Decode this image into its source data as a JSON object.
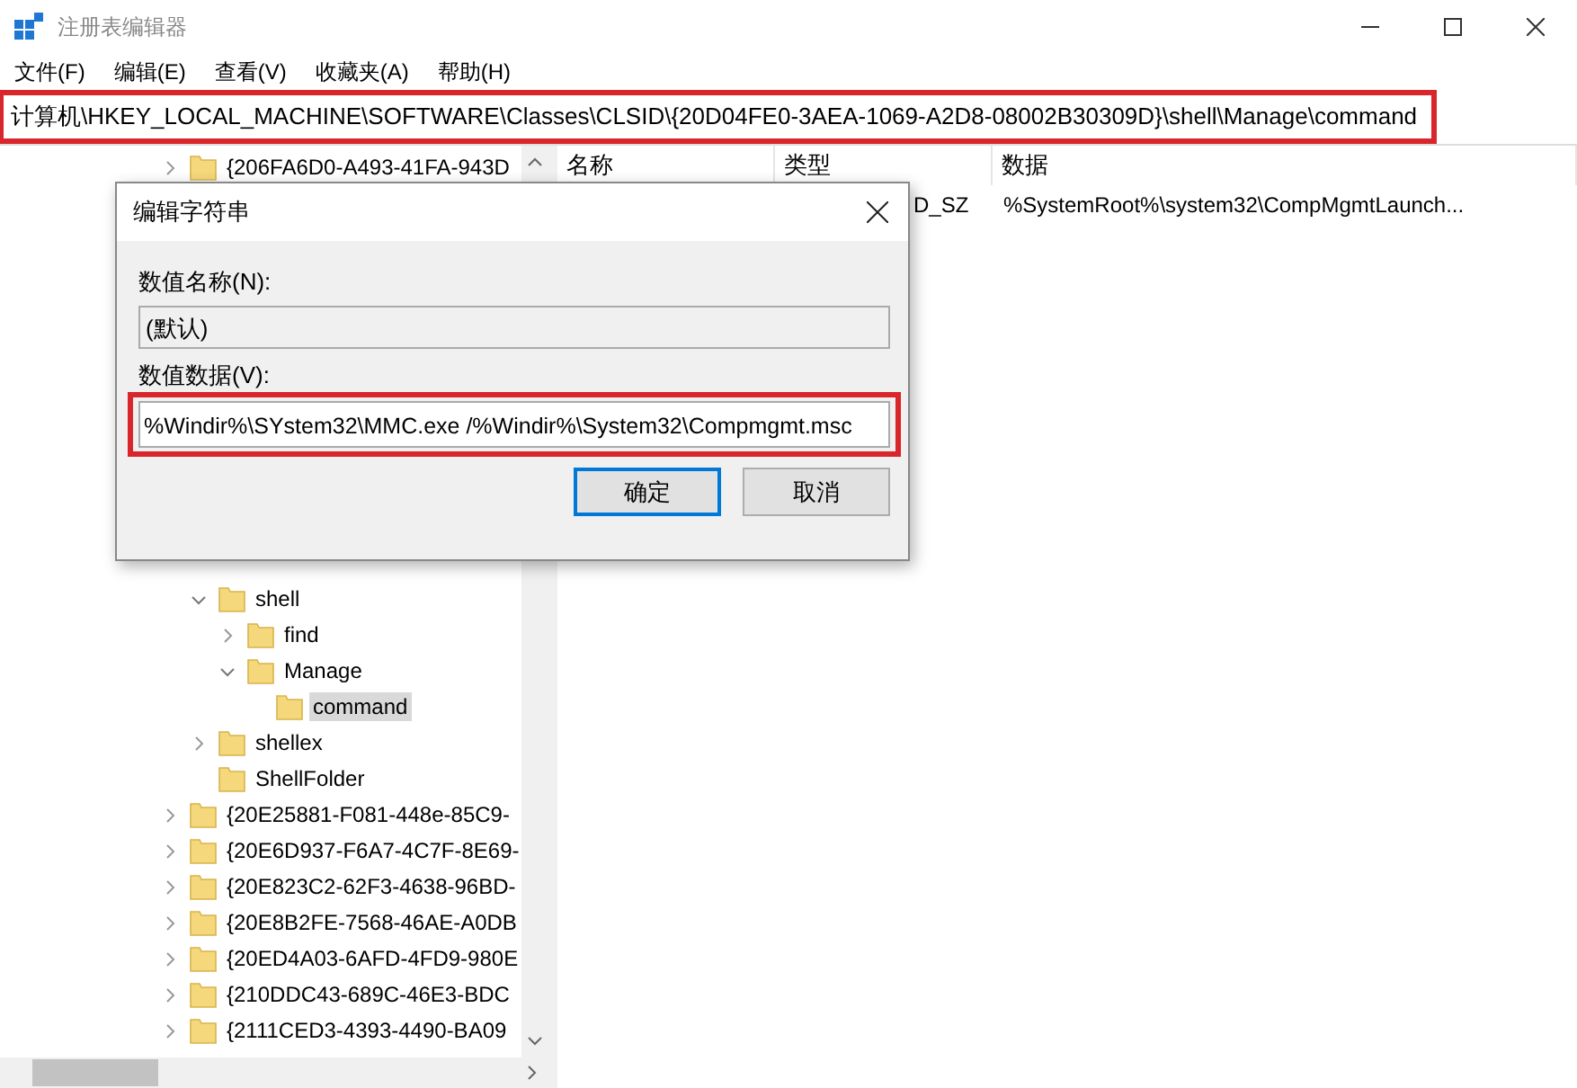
{
  "window": {
    "title": "注册表编辑器"
  },
  "menu": [
    "文件(F)",
    "编辑(E)",
    "查看(V)",
    "收藏夹(A)",
    "帮助(H)"
  ],
  "address_bar": {
    "path": "计算机\\HKEY_LOCAL_MACHINE\\SOFTWARE\\Classes\\CLSID\\{20D04FE0-3AEA-1069-A2D8-08002B30309D}\\shell\\Manage\\command",
    "highlighted": true
  },
  "tree": {
    "top_items": [
      {
        "label": "{206FA6D0-A493-41FA-943D",
        "kind": "branch",
        "expanded": false,
        "selected": false
      }
    ],
    "open_branch": [
      {
        "label": "shell",
        "kind": "branch",
        "expanded": true,
        "selected": false,
        "children": [
          {
            "label": "find",
            "kind": "branch",
            "expanded": false,
            "selected": false
          },
          {
            "label": "Manage",
            "kind": "branch",
            "expanded": true,
            "selected": false,
            "children": [
              {
                "label": "command",
                "kind": "leaf",
                "selected": true
              }
            ]
          }
        ]
      },
      {
        "label": "shellex",
        "kind": "branch",
        "expanded": false,
        "selected": false
      },
      {
        "label": "ShellFolder",
        "kind": "leaf",
        "selected": false
      }
    ],
    "more_items": [
      {
        "label": "{20E25881-F081-448e-85C9-",
        "kind": "branch",
        "expanded": false,
        "selected": false
      },
      {
        "label": "{20E6D937-F6A7-4C7F-8E69-",
        "kind": "branch",
        "expanded": false,
        "selected": false
      },
      {
        "label": "{20E823C2-62F3-4638-96BD-",
        "kind": "branch",
        "expanded": false,
        "selected": false
      },
      {
        "label": "{20E8B2FE-7568-46AE-A0DB",
        "kind": "branch",
        "expanded": false,
        "selected": false
      },
      {
        "label": "{20ED4A03-6AFD-4FD9-980E",
        "kind": "branch",
        "expanded": false,
        "selected": false
      },
      {
        "label": "{210DDC43-689C-46E3-BDC",
        "kind": "branch",
        "expanded": false,
        "selected": false
      },
      {
        "label": "{2111CED3-4393-4490-BA09",
        "kind": "branch",
        "expanded": false,
        "selected": false
      }
    ]
  },
  "values_table": {
    "columns": [
      "名称",
      "类型",
      "数据"
    ],
    "rows": [
      {
        "type": "D_SZ",
        "data": "%SystemRoot%\\system32\\CompMgmtLaunch..."
      }
    ]
  },
  "dialog": {
    "title": "编辑字符串",
    "name_label": "数值名称(N):",
    "name_value": "(默认)",
    "data_label": "数值数据(V):",
    "data_value": "%Windir%\\SYstem32\\MMC.exe /%Windir%\\System32\\Compmgmt.msc",
    "data_highlighted": true,
    "buttons": [
      {
        "label": "确定",
        "kind": "default"
      },
      {
        "label": "取消",
        "kind": "normal"
      }
    ]
  }
}
